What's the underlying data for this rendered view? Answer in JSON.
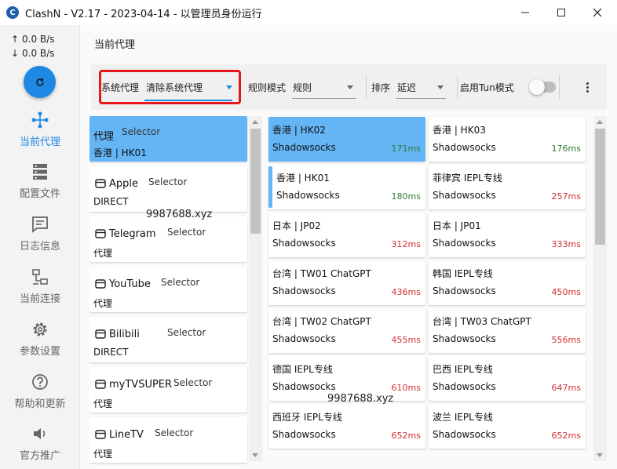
{
  "window": {
    "app_icon_letter": "C",
    "title": "ClashN - V2.17 - 2023-04-14 - 以管理员身份运行"
  },
  "speed": {
    "up": "0.0 B/s",
    "down": "0.0 B/s"
  },
  "nav": [
    {
      "label": "当前代理",
      "icon": "proxy-nodes-icon",
      "active": true
    },
    {
      "label": "配置文件",
      "icon": "server-stack-icon",
      "active": false
    },
    {
      "label": "日志信息",
      "icon": "log-message-icon",
      "active": false
    },
    {
      "label": "当前连接",
      "icon": "network-connections-icon",
      "active": false
    },
    {
      "label": "参数设置",
      "icon": "gear-icon",
      "active": false
    },
    {
      "label": "帮助和更新",
      "icon": "help-icon",
      "active": false
    },
    {
      "label": "官方推广",
      "icon": "speaker-icon",
      "active": false
    }
  ],
  "page_title": "当前代理",
  "toolbar": {
    "system_proxy_label": "系统代理",
    "system_proxy_value": "清除系统代理",
    "rule_mode_label": "规则模式",
    "rule_mode_value": "规则",
    "sort_label": "排序",
    "sort_value": "延迟",
    "tun_label": "启用Tun模式",
    "tun_enabled": false
  },
  "colors": {
    "accent": "#1e88e5",
    "selected_card": "#64b5f6",
    "highlight_box": "#e8151b",
    "delay_good": "#2e7d32",
    "delay_bad": "#d32f2f"
  },
  "groups": [
    {
      "icon": "",
      "name": "代理",
      "type": "Selector",
      "now": "香港 | HK01",
      "active": true
    },
    {
      "icon": "apple-icon",
      "name": "Apple",
      "type": "Selector",
      "now": "DIRECT",
      "active": false
    },
    {
      "icon": "telegram-icon",
      "name": "Telegram",
      "type": "Selector",
      "now": "代理",
      "active": false
    },
    {
      "icon": "clapper-icon",
      "name": "YouTube",
      "type": "Selector",
      "now": "代理",
      "active": false
    },
    {
      "icon": "clapper-icon",
      "name": "Bilibili",
      "type": "Selector",
      "now": "DIRECT",
      "active": false
    },
    {
      "icon": "clapper-icon",
      "name": "myTVSUPER",
      "type": "Selector",
      "now": "代理",
      "active": false
    },
    {
      "icon": "tv-icon",
      "name": "LineTV",
      "type": "Selector",
      "now": "代理",
      "active": false
    }
  ],
  "proxies": [
    {
      "name": "香港 | HK02",
      "protocol": "Shadowsocks",
      "delay": "171ms",
      "good": true,
      "state": "active"
    },
    {
      "name": "香港 | HK03",
      "protocol": "Shadowsocks",
      "delay": "176ms",
      "good": true,
      "state": ""
    },
    {
      "name": "香港 | HK01",
      "protocol": "Shadowsocks",
      "delay": "180ms",
      "good": true,
      "state": "selected"
    },
    {
      "name": "菲律宾 IEPL专线",
      "protocol": "Shadowsocks",
      "delay": "257ms",
      "good": false,
      "state": ""
    },
    {
      "name": "日本 | JP02",
      "protocol": "Shadowsocks",
      "delay": "312ms",
      "good": false,
      "state": ""
    },
    {
      "name": "日本 | JP01",
      "protocol": "Shadowsocks",
      "delay": "333ms",
      "good": false,
      "state": ""
    },
    {
      "name": "台湾 | TW01 ChatGPT",
      "protocol": "Shadowsocks",
      "delay": "436ms",
      "good": false,
      "state": ""
    },
    {
      "name": "韩国 IEPL专线",
      "protocol": "Shadowsocks",
      "delay": "450ms",
      "good": false,
      "state": ""
    },
    {
      "name": "台湾 | TW02 ChatGPT",
      "protocol": "Shadowsocks",
      "delay": "455ms",
      "good": false,
      "state": ""
    },
    {
      "name": "台湾 | TW03 ChatGPT",
      "protocol": "Shadowsocks",
      "delay": "556ms",
      "good": false,
      "state": ""
    },
    {
      "name": "德国 IEPL专线",
      "protocol": "Shadowsocks",
      "delay": "610ms",
      "good": false,
      "state": ""
    },
    {
      "name": "巴西 IEPL专线",
      "protocol": "Shadowsocks",
      "delay": "647ms",
      "good": false,
      "state": ""
    },
    {
      "name": "西班牙 IEPL专线",
      "protocol": "Shadowsocks",
      "delay": "652ms",
      "good": false,
      "state": ""
    },
    {
      "name": "波兰 IEPL专线",
      "protocol": "Shadowsocks",
      "delay": "652ms",
      "good": false,
      "state": ""
    }
  ],
  "watermarks": [
    "9987688.xyz",
    "9987688.xyz"
  ]
}
